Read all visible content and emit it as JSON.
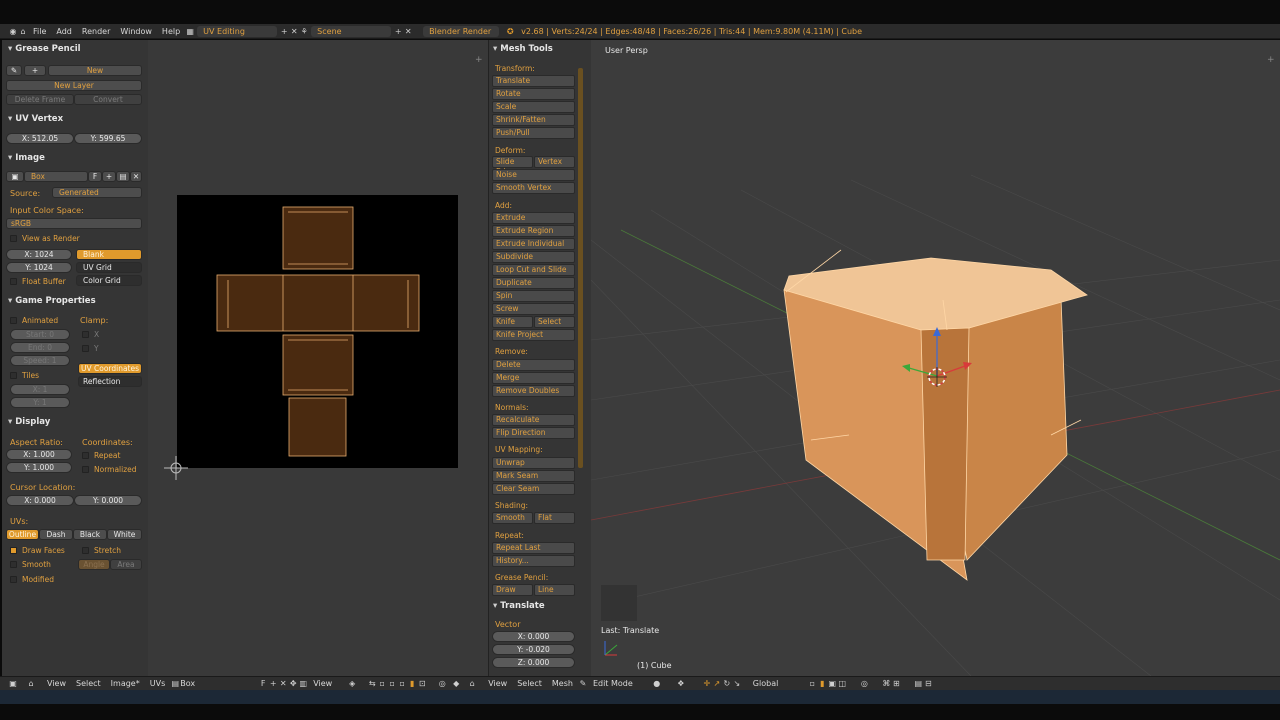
{
  "topbar": {
    "menus": [
      "File",
      "Add",
      "Render",
      "Window",
      "Help"
    ],
    "screen_layout": "UV Editing",
    "scene": "Scene",
    "engine": "Blender Render",
    "stats": "v2.68 | Verts:24/24 | Edges:48/48 | Faces:26/26 | Tris:44 | Mem:9.80M (4.11M) | Cube"
  },
  "left": {
    "grease_pencil": {
      "title": "Grease Pencil",
      "new": "New",
      "new_layer": "New Layer",
      "delete_frame": "Delete Frame",
      "convert": "Convert"
    },
    "uv_vertex": {
      "title": "UV Vertex",
      "x": "X: 512.05",
      "y": "Y: 599.65"
    },
    "image": {
      "title": "Image",
      "name": "Box",
      "f_label": "F",
      "source_label": "Source:",
      "source_value": "Generated",
      "color_space_label": "Input Color Space:",
      "color_space_value": "sRGB",
      "view_as_render": "View as Render",
      "x": "X: 1024",
      "y": "Y: 1024",
      "blank": "Blank",
      "uv_grid": "UV Grid",
      "color_grid": "Color Grid",
      "float_buffer": "Float Buffer"
    },
    "game_properties": {
      "title": "Game Properties",
      "animated": "Animated",
      "clamp": "Clamp:",
      "start": "Start: 0",
      "end": "End: 0",
      "speed": "Speed: 1",
      "clamp_x": "X",
      "clamp_y": "Y",
      "tiles": "Tiles",
      "tile_x": "X: 1",
      "tile_y": "Y: 1",
      "uv_coordinates": "UV Coordinates",
      "reflection": "Reflection"
    },
    "display": {
      "title": "Display",
      "aspect_ratio": "Aspect Ratio:",
      "coordinates": "Coordinates:",
      "ax": "X: 1.000",
      "ay": "Y: 1.000",
      "repeat": "Repeat",
      "normalized": "Normalized",
      "cursor_location": "Cursor Location:",
      "cx": "X: 0.000",
      "cy": "Y: 0.000",
      "uvs": "UVs:",
      "uv_modes": [
        "Outline",
        "Dash",
        "Black",
        "White"
      ],
      "draw_faces": "Draw Faces",
      "stretch": "Stretch",
      "smooth": "Smooth",
      "angle": "Angle",
      "area": "Area",
      "modified": "Modified"
    }
  },
  "toolshelf": {
    "title": "Mesh Tools",
    "transform_head": "Transform:",
    "transform": [
      "Translate",
      "Rotate",
      "Scale",
      "Shrink/Fatten",
      "Push/Pull"
    ],
    "deform_head": "Deform:",
    "slide_edge": "Slide Edge",
    "vertex": "Vertex",
    "noise": "Noise",
    "smooth_vertex": "Smooth Vertex",
    "add_head": "Add:",
    "add": [
      "Extrude",
      "Extrude Region",
      "Extrude Individual",
      "Subdivide",
      "Loop Cut and Slide",
      "Duplicate",
      "Spin",
      "Screw"
    ],
    "knife": "Knife",
    "select": "Select",
    "knife_project": "Knife Project",
    "remove_head": "Remove:",
    "remove": [
      "Delete",
      "Merge",
      "Remove Doubles"
    ],
    "normals_head": "Normals:",
    "normals": [
      "Recalculate",
      "Flip Direction"
    ],
    "uvmap_head": "UV Mapping:",
    "uvmap": [
      "Unwrap",
      "Mark Seam",
      "Clear Seam"
    ],
    "shading_head": "Shading:",
    "smooth": "Smooth",
    "flat": "Flat",
    "repeat_head": "Repeat:",
    "repeat_last": "Repeat Last",
    "history": "History...",
    "gp_head": "Grease Pencil:",
    "draw": "Draw",
    "line": "Line",
    "translate_title": "Translate",
    "vector": "Vector",
    "vx": "X: 0.000",
    "vy": "Y: -0.020",
    "vz": "Z: 0.000"
  },
  "viewport": {
    "view_name": "User Persp",
    "last_op": "Last: Translate",
    "object_label": "(1) Cube"
  },
  "bottom": {
    "uv_menus": [
      "View",
      "Select",
      "Image*",
      "UVs"
    ],
    "image_name": "Box",
    "f": "F",
    "uv_view": "View",
    "v3d_menus": [
      "View",
      "Select",
      "Mesh"
    ],
    "mode": "Edit Mode",
    "orientation": "Global"
  },
  "colors": {
    "accent": "#e09a2c",
    "mesh": "#e8ad6e",
    "uv_face": "#4a2a10"
  }
}
